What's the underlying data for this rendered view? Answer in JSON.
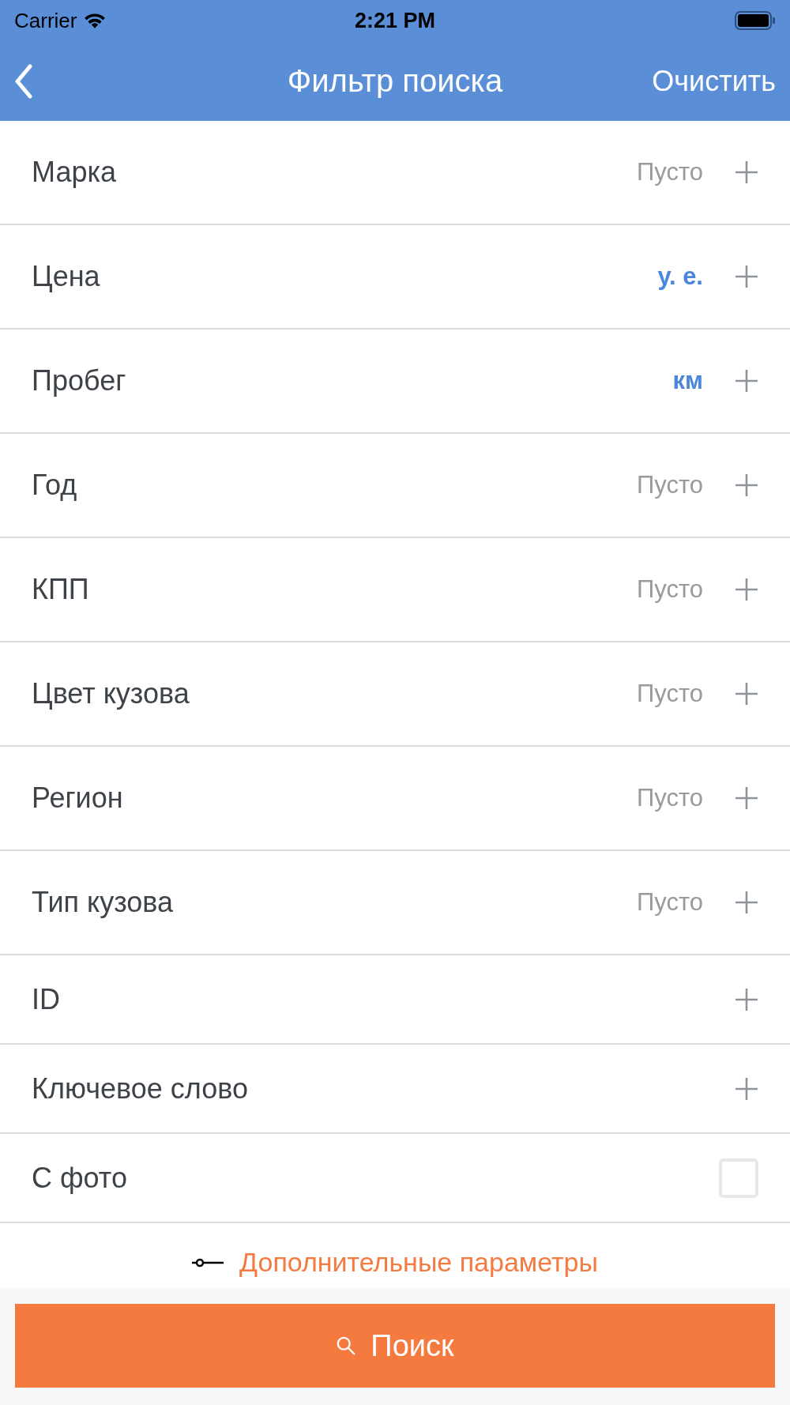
{
  "status_bar": {
    "carrier": "Carrier",
    "time": "2:21 PM"
  },
  "nav": {
    "title": "Фильтр поиска",
    "action": "Очистить"
  },
  "rows": [
    {
      "kind": "add",
      "label": "Марка",
      "value": "Пусто",
      "highlighted": false
    },
    {
      "kind": "add",
      "label": "Цена",
      "value": "у. е.",
      "highlighted": true
    },
    {
      "kind": "add",
      "label": "Пробег",
      "value": "км",
      "highlighted": true
    },
    {
      "kind": "add",
      "label": "Год",
      "value": "Пусто",
      "highlighted": false
    },
    {
      "kind": "add",
      "label": "КПП",
      "value": "Пусто",
      "highlighted": false
    },
    {
      "kind": "add",
      "label": "Цвет кузова",
      "value": "Пусто",
      "highlighted": false
    },
    {
      "kind": "add",
      "label": "Регион",
      "value": "Пусто",
      "highlighted": false
    },
    {
      "kind": "add",
      "label": "Тип кузова",
      "value": "Пусто",
      "highlighted": false
    },
    {
      "kind": "add",
      "label": "ID"
    },
    {
      "kind": "add",
      "label": "Ключевое слово"
    },
    {
      "kind": "checkbox",
      "label": "С фото",
      "checked": false
    }
  ],
  "more_link": "Дополнительные параметры",
  "search_button": "Поиск"
}
